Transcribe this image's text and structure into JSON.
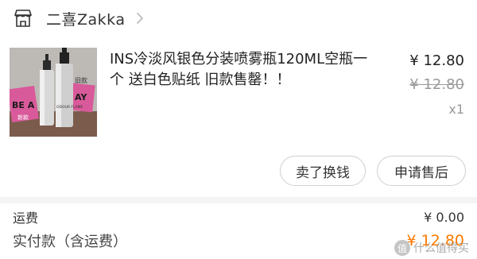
{
  "shop": {
    "name": "二喜Zakka"
  },
  "product": {
    "title": "INS冷淡风银色分装喷雾瓶120ML空瓶一个 送白色贴纸 旧款售罄！！",
    "price": "¥ 12.80",
    "original_price": "¥ 12.80",
    "quantity": "x1",
    "image_texts": {
      "sticker_left": "BE A",
      "sticker_left_sub": "新款",
      "sticker_right": "AY",
      "old_label": "旧款",
      "bottle_text": "ODOUR FLAME"
    }
  },
  "actions": {
    "sell_change_label": "卖了换钱",
    "after_sale_label": "申请售后"
  },
  "summary": {
    "shipping_label": "运费",
    "shipping_value": "¥ 0.00",
    "paid_label": "实付款（含运费）",
    "paid_value": "¥ 12.80"
  },
  "watermark": {
    "icon_char": "值",
    "text": "什么值得买"
  },
  "colors": {
    "accent": "#ff7a00",
    "muted": "#999999",
    "sticker_pink": "#d95a9a"
  }
}
